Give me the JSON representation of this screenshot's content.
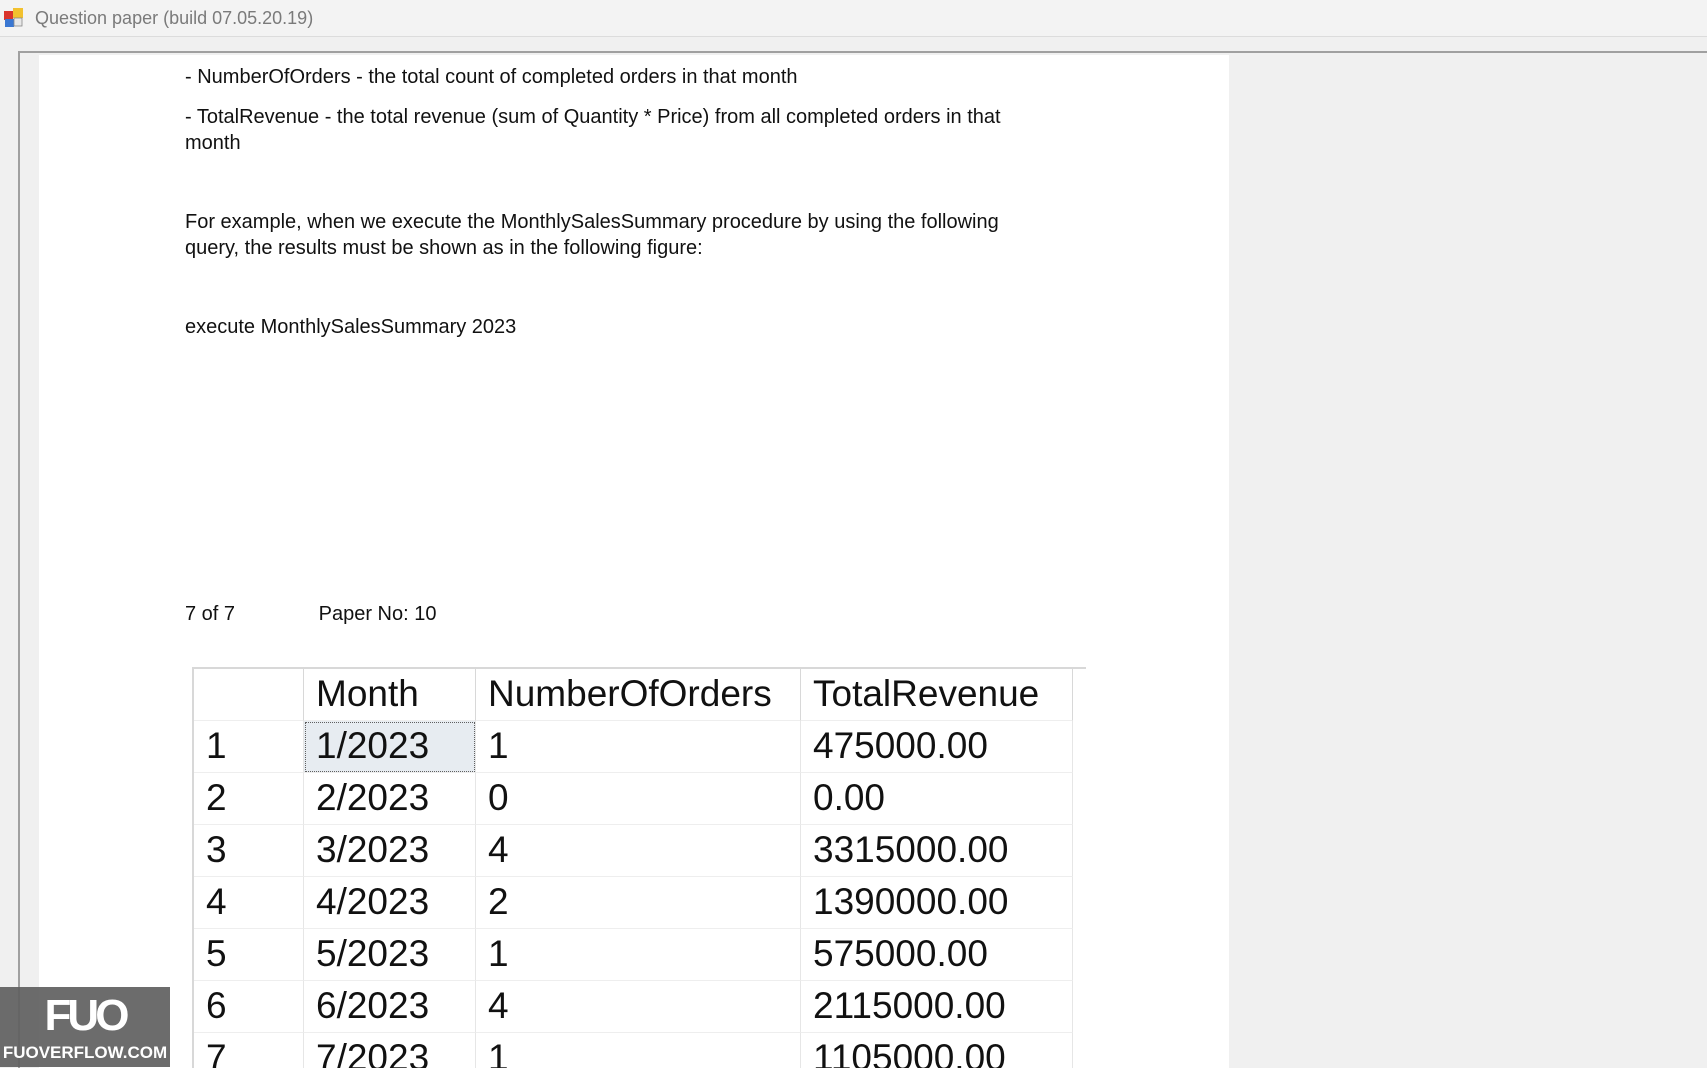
{
  "window": {
    "title": "Question paper (build 07.05.20.19)"
  },
  "document": {
    "lines": [
      "- NumberOfOrders - the total count of completed orders in that month",
      "- TotalRevenue - the total revenue (sum of Quantity * Price) from all completed orders in that",
      "month",
      "For example, when we execute the MonthlySalesSummary procedure by using the following",
      "query, the results must be shown as in the following figure:",
      "execute MonthlySalesSummary 2023"
    ],
    "footer": {
      "page": "7 of 7",
      "paper_no": "Paper No: 10"
    }
  },
  "result_grid": {
    "columns": [
      "",
      "Month",
      "NumberOfOrders",
      "TotalRevenue"
    ],
    "rows": [
      [
        "1",
        "1/2023",
        "1",
        "475000.00"
      ],
      [
        "2",
        "2/2023",
        "0",
        "0.00"
      ],
      [
        "3",
        "3/2023",
        "4",
        "3315000.00"
      ],
      [
        "4",
        "4/2023",
        "2",
        "1390000.00"
      ],
      [
        "5",
        "5/2023",
        "1",
        "575000.00"
      ],
      [
        "6",
        "6/2023",
        "4",
        "2115000.00"
      ],
      [
        "7",
        "7/2023",
        "1",
        "1105000.00"
      ]
    ],
    "selected_cell": "1/2023"
  },
  "watermark": {
    "logo": "FUO",
    "site": "FUOVERFLOW.COM"
  },
  "colors": {
    "page_background": "#ffffff",
    "app_background": "#f0f0f0",
    "title_text": "#7a7a7a",
    "selected_cell_bg": "#e7ecf1"
  }
}
